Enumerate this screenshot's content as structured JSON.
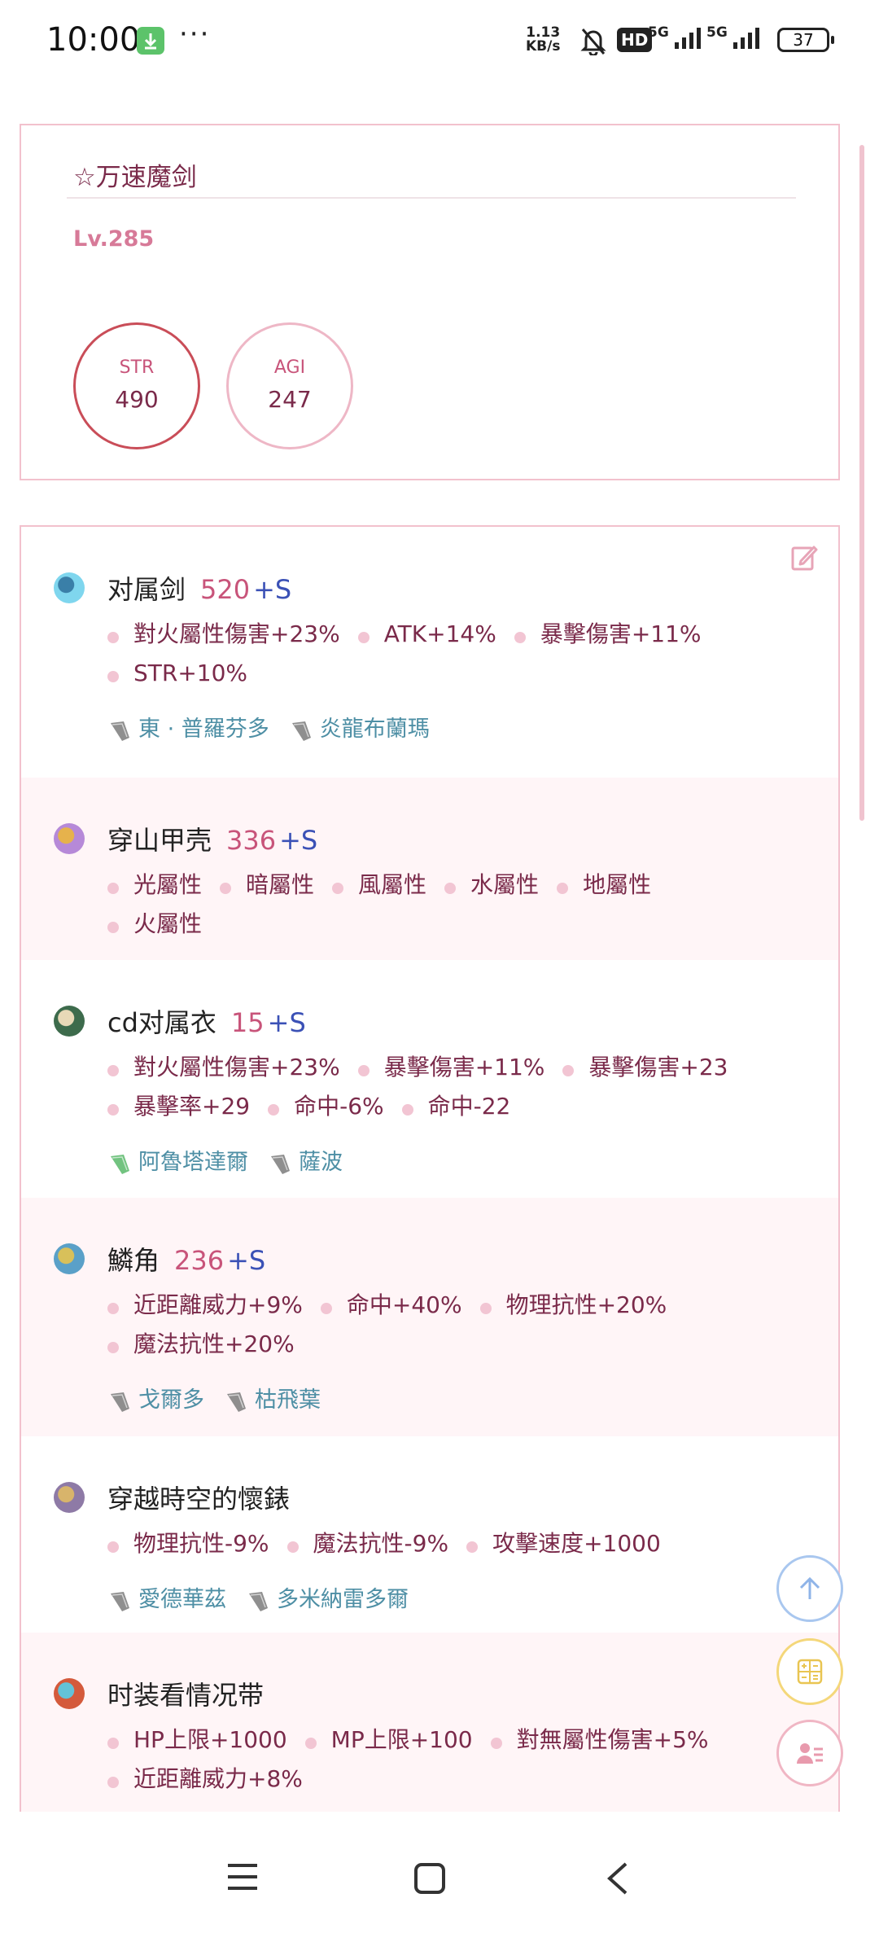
{
  "status_bar": {
    "time": "10:00",
    "overflow": "···",
    "net_speed_value": "1.13",
    "net_speed_unit": "KB/s",
    "hd_badge": "HD",
    "signal_1": "5G",
    "signal_2": "5G",
    "battery": "37"
  },
  "character": {
    "name": "☆万速魔剑",
    "level": "Lv.285",
    "stats": [
      {
        "label": "STR",
        "value": "490"
      },
      {
        "label": "AGI",
        "value": "247"
      }
    ]
  },
  "equipment": [
    {
      "icon": "sword-icon",
      "name": "对属剑",
      "refine": "520",
      "plus": "+S",
      "attr_lines": [
        [
          "對火屬性傷害+23%",
          "ATK+14%",
          "暴擊傷害+11%"
        ],
        [
          "STR+10%"
        ]
      ],
      "crystals": [
        "東 · 普羅芬多",
        "炎龍布蘭瑪"
      ]
    },
    {
      "icon": "shield-icon",
      "name": "穿山甲壳",
      "refine": "336",
      "plus": "+S",
      "attr_lines": [
        [
          "光屬性",
          "暗屬性",
          "風屬性",
          "水屬性",
          "地屬性"
        ],
        [
          "火屬性"
        ]
      ],
      "crystals": []
    },
    {
      "icon": "armor-icon",
      "name": "cd对属衣",
      "refine": "15",
      "plus": "+S",
      "attr_lines": [
        [
          "對火屬性傷害+23%",
          "暴擊傷害+11%",
          "暴擊傷害+23"
        ],
        [
          "暴擊率+29",
          "命中-6%",
          "命中-22"
        ]
      ],
      "crystals": [
        "阿魯塔達爾",
        "薩波"
      ]
    },
    {
      "icon": "hat-icon",
      "name": "鱗角",
      "refine": "236",
      "plus": "+S",
      "attr_lines": [
        [
          "近距離威力+9%",
          "命中+40%",
          "物理抗性+20%"
        ],
        [
          "魔法抗性+20%"
        ]
      ],
      "crystals": [
        "戈爾多",
        "枯飛葉"
      ]
    },
    {
      "icon": "pocket-watch-icon",
      "name": "穿越時空的懷錶",
      "refine": "",
      "plus": "",
      "attr_lines": [
        [
          "物理抗性-9%",
          "魔法抗性-9%",
          "攻擊速度+1000"
        ]
      ],
      "crystals": [
        "愛德華茲",
        "多米納雷多爾"
      ]
    },
    {
      "icon": "bow-tie-icon",
      "name": "时装看情况带",
      "refine": "",
      "plus": "",
      "attr_lines": [
        [
          "HP上限+1000",
          "MP上限+100",
          "對無屬性傷害+5%"
        ],
        [
          "近距離威力+8%"
        ]
      ],
      "crystals": []
    }
  ],
  "colors": {
    "accent_pink": "#c8547a",
    "text_maroon": "#7a2a4a",
    "border_pink": "#f2c1cd",
    "link_blue": "#3b51b6",
    "crystal_teal": "#4e8fa5"
  }
}
